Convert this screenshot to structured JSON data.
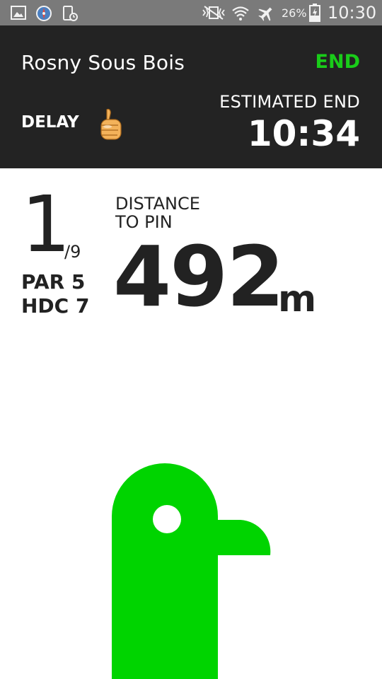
{
  "status_bar": {
    "battery_percent": "26%",
    "time": "10:30",
    "icons": [
      "gallery-icon",
      "compass-icon",
      "phone-clock-icon",
      "vibrate-icon",
      "wifi-icon",
      "airplane-icon",
      "battery-charging-icon"
    ]
  },
  "header": {
    "course_name": "Rosny Sous Bois",
    "end_label": "END",
    "delay_label": "DELAY",
    "delay_icon": "thumbs-up-icon",
    "estimated_end_label": "ESTIMATED END",
    "estimated_end_time": "10:34"
  },
  "hole": {
    "number": "1",
    "total": "/9",
    "par": "PAR 5",
    "handicap": "HDC 7"
  },
  "distance": {
    "label_line1": "DISTANCE",
    "label_line2": "TO PIN",
    "value": "492",
    "unit": "m"
  },
  "colors": {
    "accent_green": "#19cc19",
    "pin_green": "#00d400",
    "header_bg": "#232323",
    "status_bar_bg": "#7a7a7a"
  }
}
